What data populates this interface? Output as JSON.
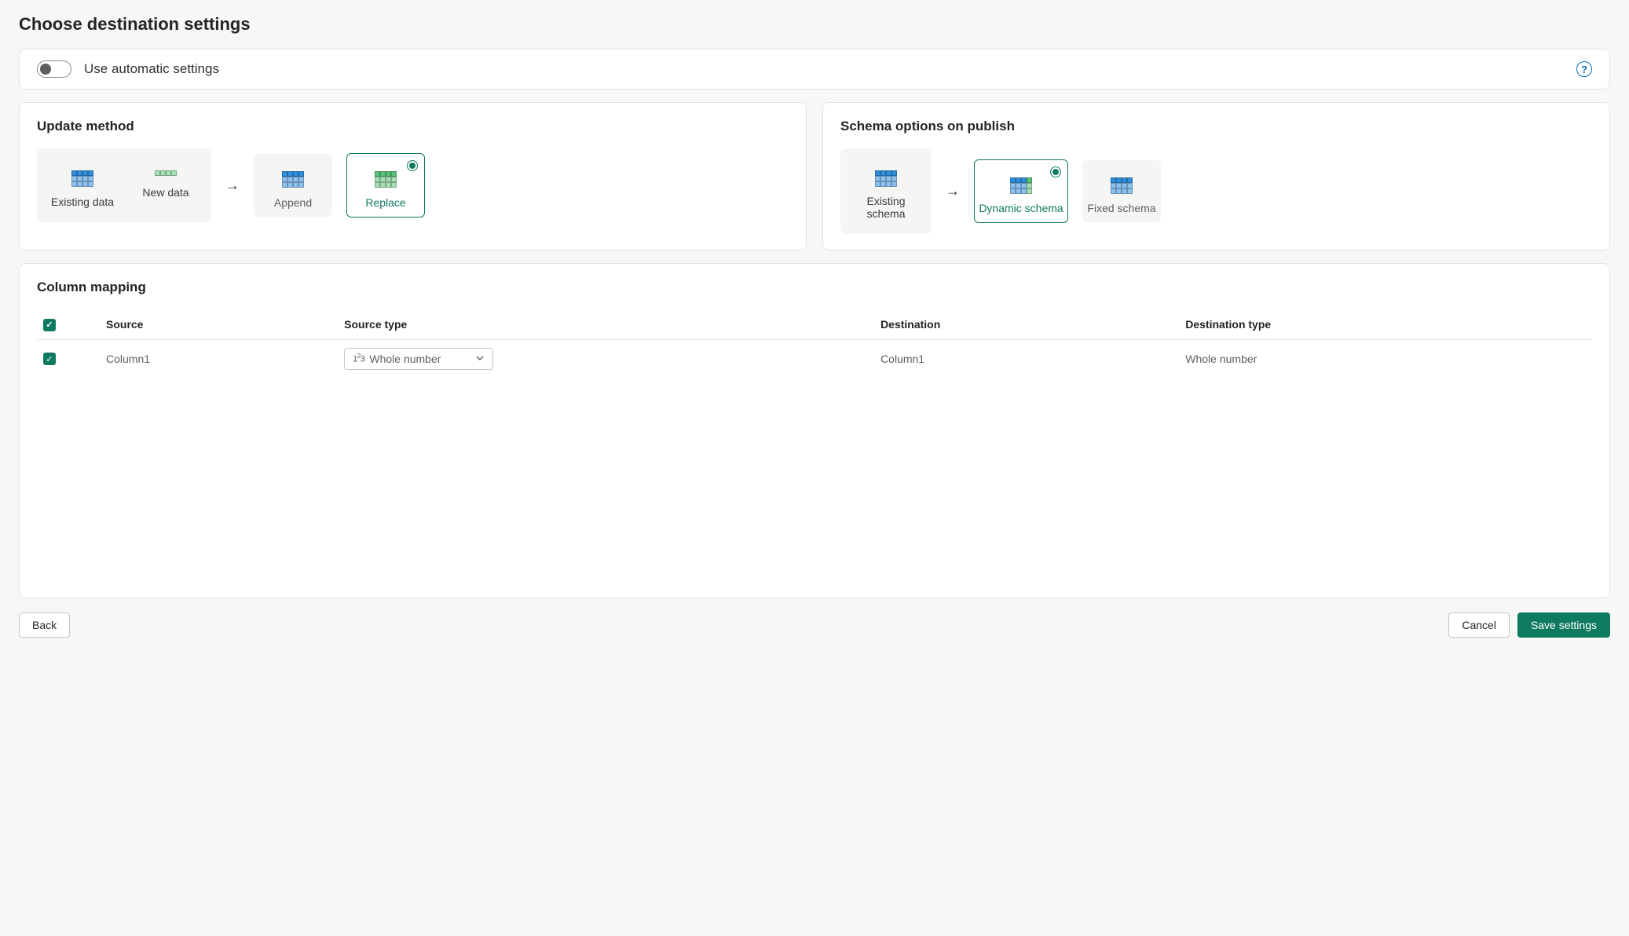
{
  "page": {
    "title": "Choose destination settings"
  },
  "autoSettings": {
    "label": "Use automatic settings",
    "enabled": false
  },
  "updateMethod": {
    "title": "Update method",
    "existingDataLabel": "Existing data",
    "newDataLabel": "New data",
    "options": {
      "append": "Append",
      "replace": "Replace"
    },
    "selected": "replace"
  },
  "schemaOptions": {
    "title": "Schema options on publish",
    "existingSchemaLabel": "Existing schema",
    "options": {
      "dynamic": "Dynamic schema",
      "fixed": "Fixed schema"
    },
    "selected": "dynamic"
  },
  "columnMapping": {
    "title": "Column mapping",
    "headers": {
      "source": "Source",
      "sourceType": "Source type",
      "destination": "Destination",
      "destinationType": "Destination type"
    },
    "rows": [
      {
        "checked": true,
        "source": "Column1",
        "sourceType": "Whole number",
        "destination": "Column1",
        "destinationType": "Whole number"
      }
    ]
  },
  "footer": {
    "back": "Back",
    "cancel": "Cancel",
    "save": "Save settings"
  }
}
